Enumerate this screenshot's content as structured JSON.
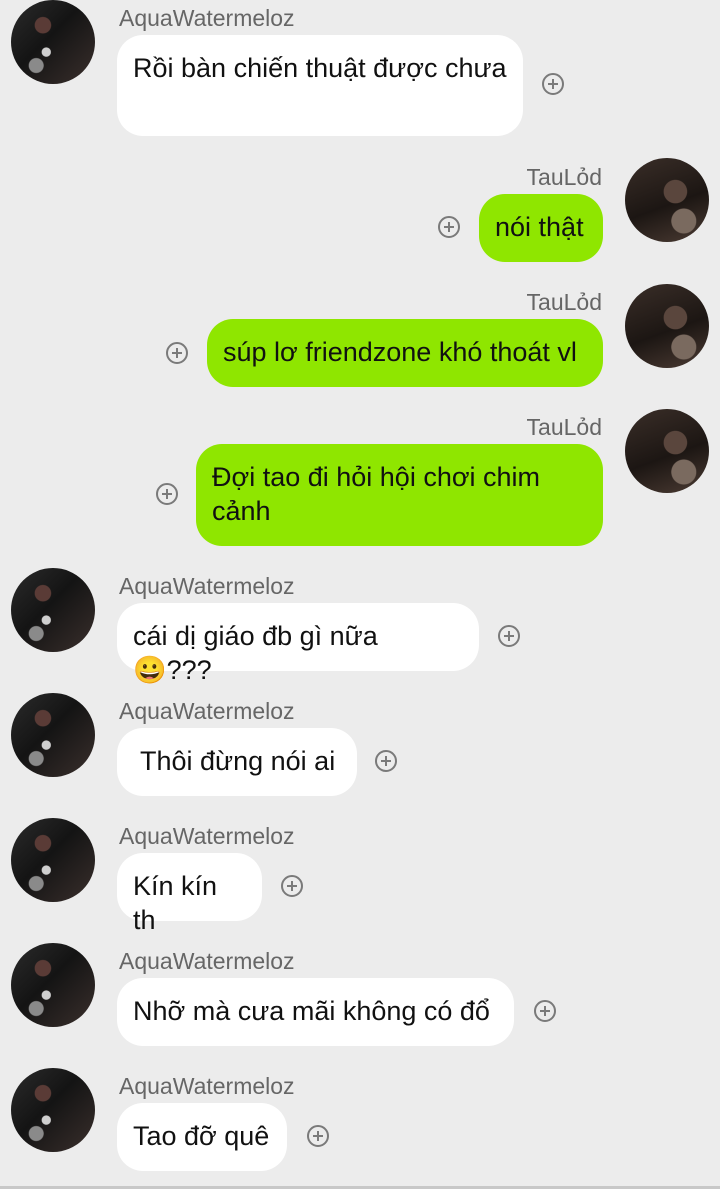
{
  "messages": [
    {
      "sender": "AquaWatermeloz",
      "text": "Rồi bàn chiến thuật được chưa",
      "direction": "incoming"
    },
    {
      "sender": "TauLỏd",
      "text": "nói thật",
      "direction": "outgoing"
    },
    {
      "sender": "TauLỏd",
      "text": "súp lơ friendzone khó thoát vl",
      "direction": "outgoing"
    },
    {
      "sender": "TauLỏd",
      "text": "Đợi tao đi hỏi hội chơi chim cảnh",
      "direction": "outgoing"
    },
    {
      "sender": "AquaWatermeloz",
      "text": "cái dị giáo đb gì nữa 😀???",
      "direction": "incoming"
    },
    {
      "sender": "AquaWatermeloz",
      "text": "Thôi đừng nói ai",
      "direction": "incoming"
    },
    {
      "sender": "AquaWatermeloz",
      "text": "Kín kín th",
      "direction": "incoming"
    },
    {
      "sender": "AquaWatermeloz",
      "text": "Nhỡ mà cưa mãi không có đổ",
      "direction": "incoming"
    },
    {
      "sender": "AquaWatermeloz",
      "text": "Tao đỡ quê",
      "direction": "incoming"
    }
  ],
  "icons": {
    "avatar": "user-photo",
    "add_reaction": "plus-circle-icon"
  },
  "colors": {
    "background": "#ececec",
    "incoming_bubble": "#ffffff",
    "outgoing_bubble": "#8fe600"
  }
}
